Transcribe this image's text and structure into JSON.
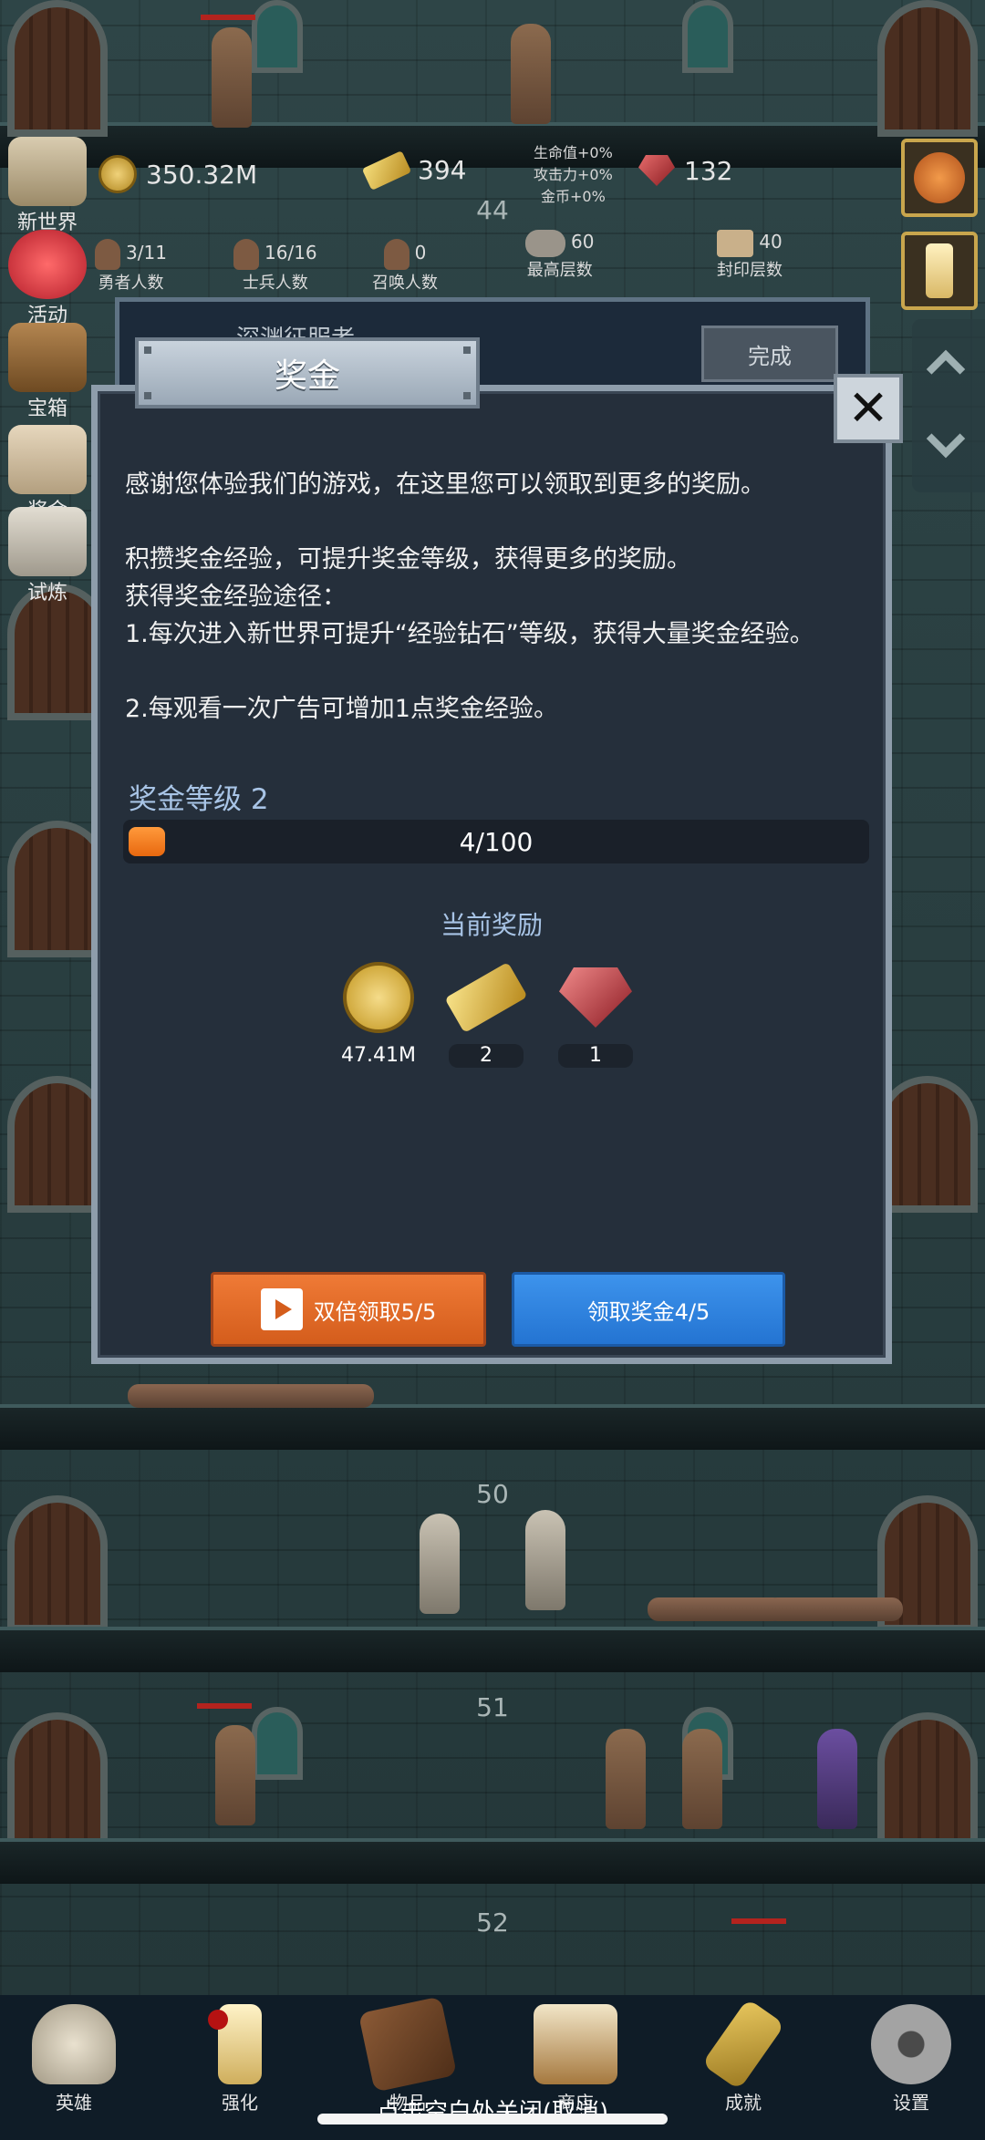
{
  "hud": {
    "gold": "350.32M",
    "gold_bars": "394",
    "gems": "132",
    "floor_top": "44",
    "modifiers": [
      "生命值+0%",
      "攻击力+0%",
      "金币+0%"
    ],
    "counts": [
      {
        "value": "3/11",
        "label": "勇者人数"
      },
      {
        "value": "16/16",
        "label": "士兵人数"
      },
      {
        "value": "0",
        "label": "召唤人数"
      },
      {
        "value": "60",
        "label": "最高层数"
      },
      {
        "value": "40",
        "label": "封印层数"
      }
    ]
  },
  "side_menu": [
    {
      "label": "新世界",
      "icon": "map-icon"
    },
    {
      "label": "活动",
      "icon": "heart-icon"
    },
    {
      "label": "宝箱",
      "icon": "chest-icon"
    },
    {
      "label": "奖金",
      "icon": "envelope-icon"
    },
    {
      "label": "试炼",
      "icon": "quill-icon"
    }
  ],
  "quest": {
    "title": "深渊征服者",
    "done_label": "完成"
  },
  "modal": {
    "title": "奖金",
    "paragraphs": [
      "感谢您体验我们的游戏，在这里您可以领取到更多的奖励。",
      "积攒奖金经验，可提升奖金等级，获得更多的奖励。",
      "获得奖金经验途径：",
      "1.每次进入新世界可提升“经验钻石”等级，获得大量奖金经验。",
      "2.每观看一次广告可增加1点奖金经验。"
    ],
    "level_label": "奖金等级 2",
    "progress_text": "4/100",
    "progress_fraction": 0.04,
    "reward_title": "当前奖励",
    "rewards": [
      {
        "icon": "gold-coin-icon",
        "qty": "47.41M"
      },
      {
        "icon": "gold-bar-icon",
        "qty": "2"
      },
      {
        "icon": "ruby-icon",
        "qty": "1"
      }
    ],
    "double_button": "双倍领取5/5",
    "claim_button": "领取奖金4/5"
  },
  "floors": [
    "50",
    "51",
    "52"
  ],
  "bottom_nav": [
    {
      "label": "英雄",
      "icon": "skull-icon"
    },
    {
      "label": "强化",
      "icon": "candle-icon"
    },
    {
      "label": "物品",
      "icon": "book-icon"
    },
    {
      "label": "商店",
      "icon": "mug-icon"
    },
    {
      "label": "成就",
      "icon": "key-icon"
    },
    {
      "label": "设置",
      "icon": "gear-icon"
    }
  ],
  "hint": "点击空白处关闭(取消)",
  "colors": {
    "accent_orange": "#e8680f",
    "accent_blue": "#2474d2",
    "panel": "#252f3b",
    "label_blue": "#a8c4e6"
  }
}
